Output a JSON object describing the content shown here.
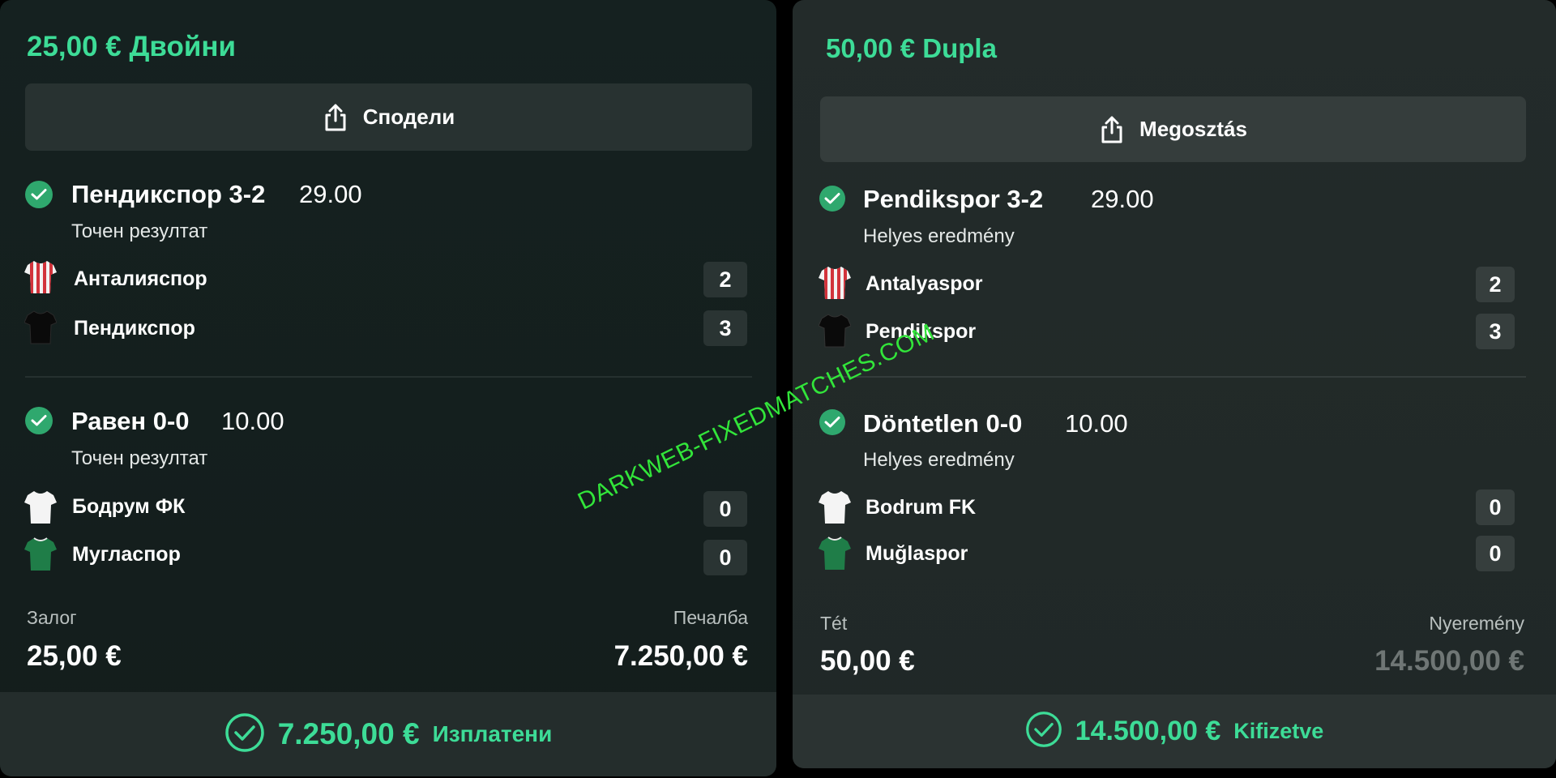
{
  "colors": {
    "accent": "#3ddc97",
    "check": "#2fa86e",
    "watermark": "#32e53a"
  },
  "icons": {
    "share": "share-icon",
    "check": "check-icon",
    "paid": "check-circle-icon"
  },
  "left": {
    "title": "25,00 € Двойни",
    "share_label": "Сподели",
    "selections": [
      {
        "name": "Пендикспор 3-2",
        "odds": "29.00",
        "market": "Точен резултат",
        "teams": [
          {
            "name": "Анталияспор",
            "score": "2",
            "kit": "red-white-stripes-jersey"
          },
          {
            "name": "Пендикспор",
            "score": "3",
            "kit": "black-jersey"
          }
        ]
      },
      {
        "name": "Равен 0-0",
        "odds": "10.00",
        "market": "Точен резултат",
        "teams": [
          {
            "name": "Бодрум ФК",
            "score": "0",
            "kit": "white-jersey"
          },
          {
            "name": "Мугласпор",
            "score": "0",
            "kit": "green-jersey"
          }
        ]
      }
    ],
    "stake_label": "Залог",
    "stake_value": "25,00 €",
    "win_label": "Печалба",
    "win_value": "7.250,00 €",
    "paid_amount": "7.250,00 €",
    "paid_label": "Изплатени"
  },
  "right": {
    "title": "50,00 € Dupla",
    "share_label": "Megosztás",
    "selections": [
      {
        "name": "Pendikspor 3-2",
        "odds": "29.00",
        "market": "Helyes eredmény",
        "teams": [
          {
            "name": "Antalyaspor",
            "score": "2",
            "kit": "red-white-stripes-jersey"
          },
          {
            "name": "Pendikspor",
            "score": "3",
            "kit": "black-jersey"
          }
        ]
      },
      {
        "name": "Döntetlen 0-0",
        "odds": "10.00",
        "market": "Helyes eredmény",
        "teams": [
          {
            "name": "Bodrum FK",
            "score": "0",
            "kit": "white-jersey"
          },
          {
            "name": "Muğlaspor",
            "score": "0",
            "kit": "green-jersey"
          }
        ]
      }
    ],
    "stake_label": "Tét",
    "stake_value": "50,00 €",
    "win_label": "Nyeremény",
    "win_value": "14.500,00 €",
    "paid_amount": "14.500,00 €",
    "paid_label": "Kifizetve"
  },
  "watermark": "DARKWEB-FIXEDMATCHES.COM"
}
